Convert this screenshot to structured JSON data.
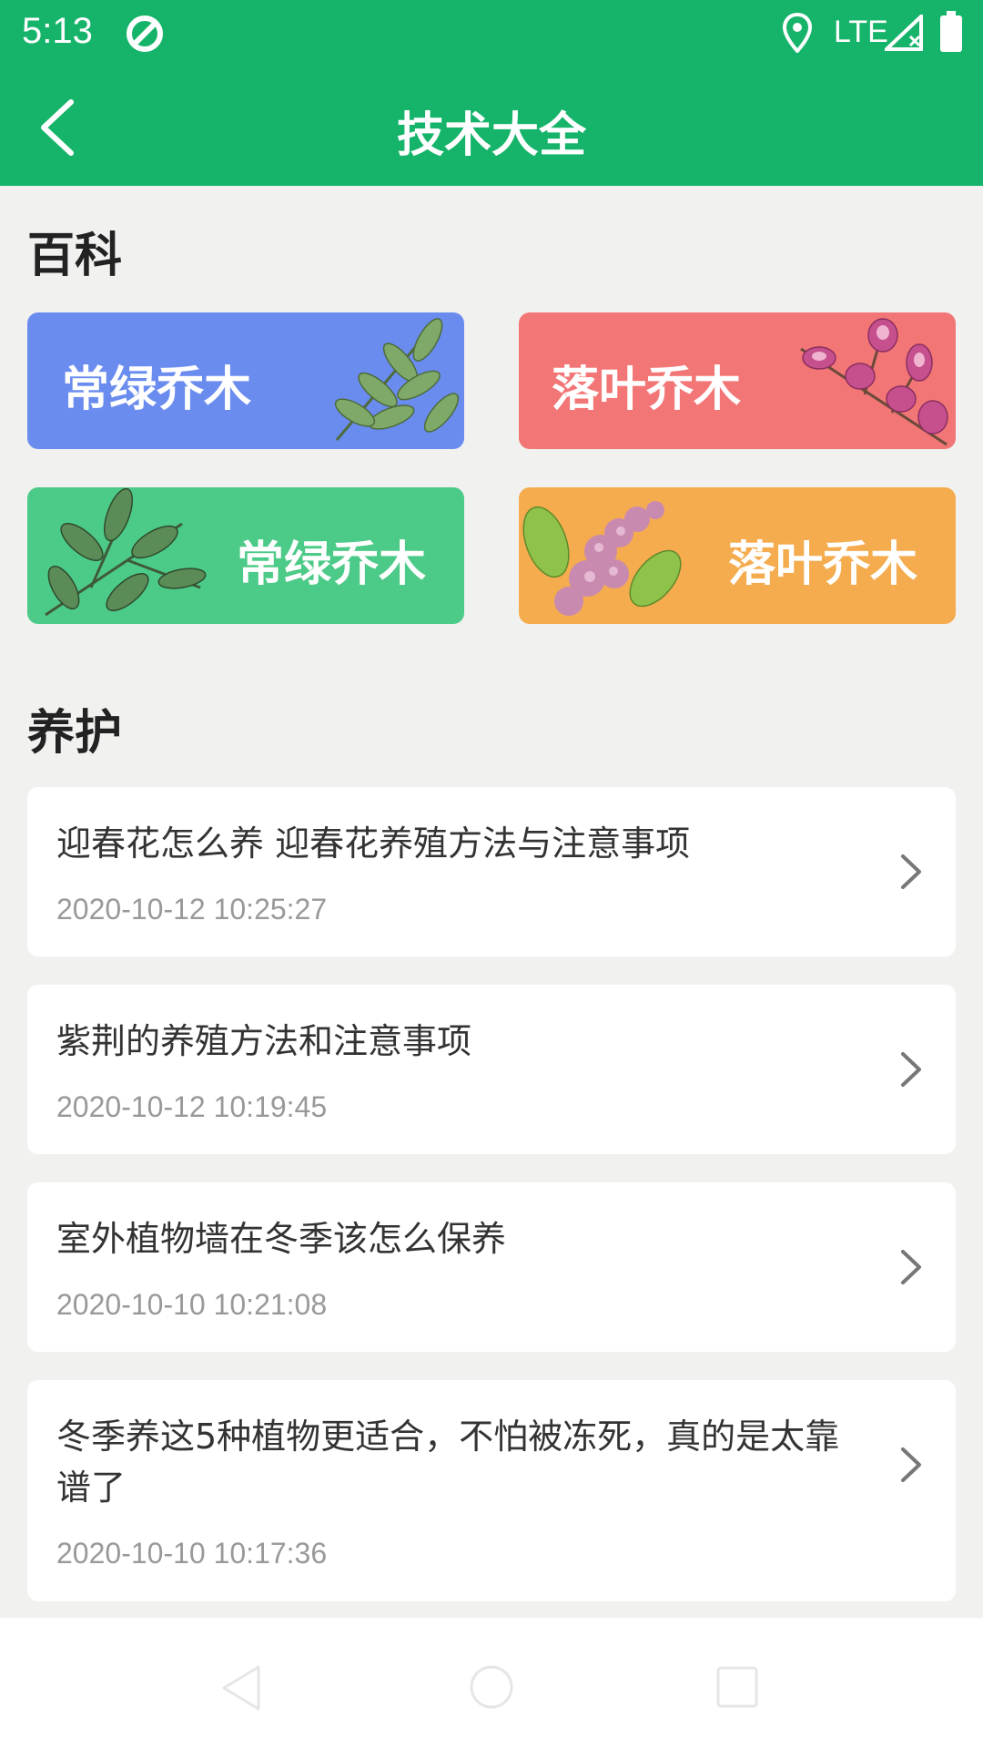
{
  "status_bar": {
    "time": "5:13",
    "network": "LTE"
  },
  "app_bar": {
    "title": "技术大全"
  },
  "encyclopedia": {
    "heading": "百科",
    "cards": [
      {
        "label": "常绿乔木",
        "color": "#6b8cef",
        "image": "leaf-branch"
      },
      {
        "label": "落叶乔木",
        "color": "#f37676",
        "image": "magnolia-flowers"
      },
      {
        "label": "常绿乔木",
        "color": "#4cca87",
        "image": "leafy-branch"
      },
      {
        "label": "落叶乔木",
        "color": "#f5ac4f",
        "image": "lilac-flowers"
      }
    ]
  },
  "care": {
    "heading": "养护",
    "items": [
      {
        "title": "迎春花怎么养 迎春花养殖方法与注意事项",
        "date": "2020-10-12 10:25:27"
      },
      {
        "title": "紫荆的养殖方法和注意事项",
        "date": "2020-10-12 10:19:45"
      },
      {
        "title": "室外植物墙在冬季该怎么保养",
        "date": "2020-10-10 10:21:08"
      },
      {
        "title": "冬季养这5种植物更适合，不怕被冻死，真的是太靠谱了",
        "date": "2020-10-10 10:17:36"
      }
    ]
  }
}
